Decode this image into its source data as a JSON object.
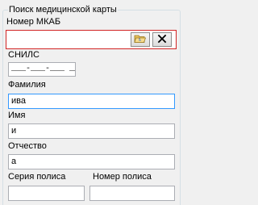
{
  "group_title": "Поиск медицинской карты",
  "mkab": {
    "label": "Номер МКАБ",
    "value": "",
    "open_icon": "folder-open-icon",
    "clear_icon": "close-x-icon"
  },
  "snils": {
    "label": "СНИЛС",
    "mask": "___-___-___ __"
  },
  "surname": {
    "label": "Фамилия",
    "value": "ива"
  },
  "first_name": {
    "label": "Имя",
    "value": "и"
  },
  "patronymic": {
    "label": "Отчество",
    "value": "а"
  },
  "policy_series": {
    "label": "Серия полиса",
    "value": ""
  },
  "policy_number": {
    "label": "Номер полиса",
    "value": ""
  },
  "colors": {
    "error_border": "#d12424",
    "focus_border": "#3399ff"
  }
}
